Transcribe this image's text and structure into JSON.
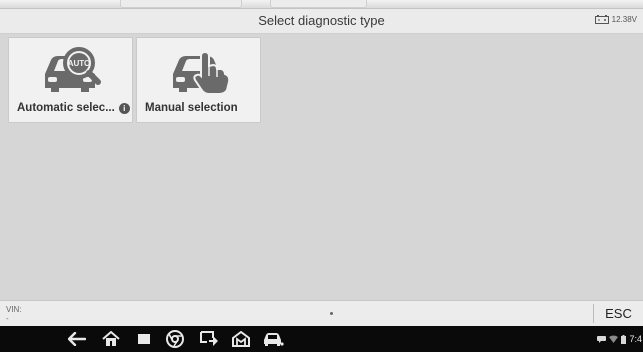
{
  "header": {
    "title": "Select diagnostic type",
    "battery_voltage": "12.38V"
  },
  "tiles": [
    {
      "label": "Automatic selec...",
      "icon": "car-auto-magnifier-icon",
      "badge": "i"
    },
    {
      "label": "Manual selection",
      "icon": "car-hand-icon"
    }
  ],
  "footer": {
    "vin_label": "VIN:",
    "vin_value": "-",
    "esc_label": "ESC"
  },
  "navbar": {
    "buttons": [
      "back-icon",
      "home-icon",
      "recent-apps-icon",
      "chrome-icon",
      "screen-capture-icon",
      "maxisys-home-icon",
      "vci-car-icon"
    ],
    "clock": "7:4"
  },
  "colors": {
    "background": "#d6d6d6",
    "tile": "#f1f1f1",
    "icon_gray": "#6a6a6a",
    "navbar": "#0a0a0a"
  }
}
